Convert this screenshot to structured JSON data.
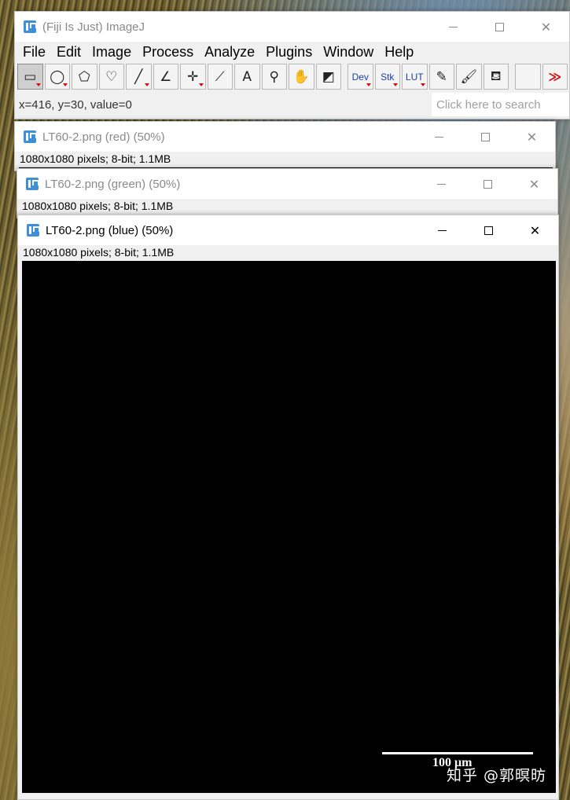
{
  "main_window": {
    "title": "(Fiji Is Just) ImageJ",
    "menus": [
      "File",
      "Edit",
      "Image",
      "Process",
      "Analyze",
      "Plugins",
      "Window",
      "Help"
    ],
    "tools": [
      {
        "name": "rectangle-tool",
        "glyph": "▭",
        "selected": true,
        "menu": true
      },
      {
        "name": "oval-tool",
        "glyph": "◯",
        "selected": false,
        "menu": true
      },
      {
        "name": "polygon-tool",
        "glyph": "⬠",
        "selected": false,
        "menu": false
      },
      {
        "name": "freehand-tool",
        "glyph": "♡",
        "selected": false,
        "menu": false
      },
      {
        "name": "line-tool",
        "glyph": "╱",
        "selected": false,
        "menu": true
      },
      {
        "name": "angle-tool",
        "glyph": "∠",
        "selected": false,
        "menu": false
      },
      {
        "name": "point-tool",
        "glyph": "✛",
        "selected": false,
        "menu": true
      },
      {
        "name": "wand-tool",
        "glyph": "⟋",
        "selected": false,
        "menu": false
      },
      {
        "name": "text-tool",
        "glyph": "A",
        "selected": false,
        "menu": false
      },
      {
        "name": "magnifier-tool",
        "glyph": "⚲",
        "selected": false,
        "menu": false
      },
      {
        "name": "hand-tool",
        "glyph": "✋",
        "selected": false,
        "menu": false
      },
      {
        "name": "color-picker-tool",
        "glyph": "◩",
        "selected": false,
        "menu": false
      }
    ],
    "extra_tools": [
      {
        "name": "dev-tool",
        "label": "Dev",
        "menu": true
      },
      {
        "name": "stk-tool",
        "label": "Stk",
        "menu": true
      },
      {
        "name": "lut-tool",
        "label": "LUT",
        "menu": true
      },
      {
        "name": "pencil-tool",
        "label": "✎",
        "menu": false
      },
      {
        "name": "brush-tool",
        "label": "🖌",
        "menu": false
      },
      {
        "name": "flood-fill-tool",
        "label": "⛾",
        "menu": false
      }
    ],
    "more_label": "≫",
    "status": "x=416, y=30, value=0",
    "search_placeholder": "Click here to search"
  },
  "image_windows": [
    {
      "id": "red",
      "title": "LT60-2.png (red) (50%)",
      "info": "1080x1080 pixels; 8-bit; 1.1MB",
      "active": false
    },
    {
      "id": "green",
      "title": "LT60-2.png (green) (50%)",
      "info": "1080x1080 pixels; 8-bit; 1.1MB",
      "active": false
    },
    {
      "id": "blue",
      "title": "LT60-2.png (blue) (50%)",
      "info": "1080x1080 pixels; 8-bit; 1.1MB",
      "active": true
    }
  ],
  "scale_bar_label": "100 μm",
  "watermark": "知乎 @郭暝昉",
  "window_controls": {
    "minimize": "",
    "maximize": "",
    "close": "✕"
  }
}
